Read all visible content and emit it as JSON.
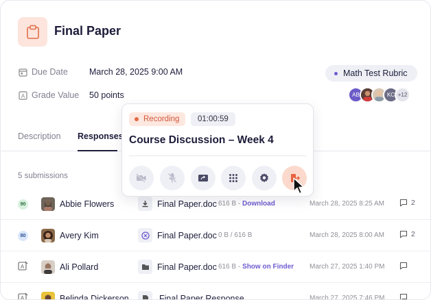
{
  "assignment": {
    "title": "Final Paper",
    "due_label": "Due Date",
    "due_value": "March 28, 2025 9:00 AM",
    "grade_label": "Grade Value",
    "grade_value": "50 points",
    "rubric": "Math Test Rubric",
    "avatars_extra": "+12"
  },
  "avatar_initials": [
    "AB",
    "KC"
  ],
  "tabs": [
    "Description",
    "Responses"
  ],
  "submissions_label": "5 submissions",
  "rows": [
    {
      "grade": "90",
      "name": "Abbie Flowers",
      "file": "Final Paper.doc",
      "size": "616 B - ",
      "action": "Download",
      "date": "March 28, 2025 8:25 AM",
      "comments": "2"
    },
    {
      "grade": "80",
      "name": "Avery Kim",
      "file": "Final Paper.doc",
      "size": "0 B / 616 B",
      "action": "",
      "date": "March 28, 2025 8:00 AM",
      "comments": "2"
    },
    {
      "grade": "",
      "name": "Ali Pollard",
      "file": "Final Paper.doc",
      "size": "616 B - ",
      "action": "Show on Finder",
      "date": "March 27, 2025 1:40 PM",
      "comments": ""
    },
    {
      "grade": "",
      "name": "Belinda Dickerson",
      "file": "Final Paper Response",
      "size": "",
      "action": "",
      "date": "March 27, 2025 7:46 PM",
      "comments": ""
    }
  ],
  "call": {
    "recording_label": "Recording",
    "timer": "01:00:59",
    "title": "Course Discussion – Week 4"
  },
  "colors": {
    "accent": "#6d5bd0",
    "recording": "#e56a46",
    "leave": "#fbd9cc"
  }
}
